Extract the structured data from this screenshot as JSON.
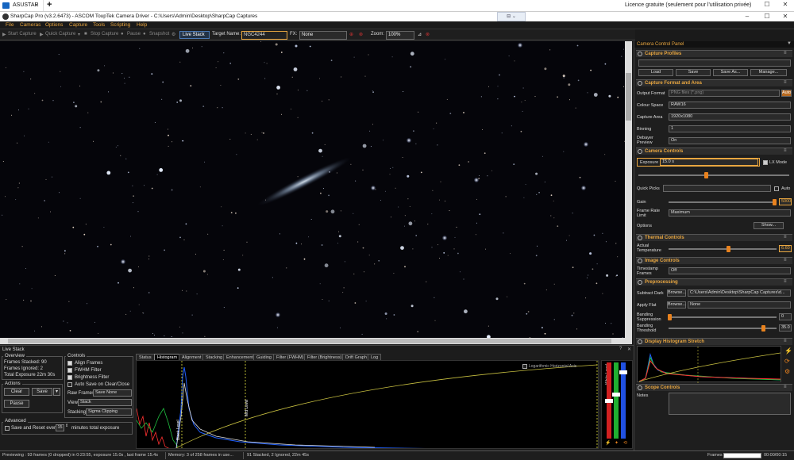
{
  "remote_tab": {
    "label": "ASUSTAR",
    "close": "×",
    "new": "+"
  },
  "license": "Licence gratuite (seulement pour l'utilisation privée)",
  "window": {
    "title": "SharpCap Pro (v3.2.6473) - ASCOM ToupTek Camera Driver - C:\\Users\\Admin\\Desktop\\SharpCap Captures",
    "min": "–",
    "max": "☐",
    "close": "✕"
  },
  "menu": [
    "File",
    "Cameras",
    "Options",
    "Capture",
    "Tools",
    "Scripting",
    "Help"
  ],
  "toolbar": {
    "start_capture": "Start Capture",
    "quick_capture": "Quick Capture",
    "stop_capture": "Stop Capture",
    "pause": "Pause",
    "snapshot": "Snapshot",
    "live_stack": "Live Stack",
    "target_label": "Target Name:",
    "target_value": "NGC4244",
    "fx_label": "FX:",
    "fx_value": "None",
    "zoom_label": "Zoom:",
    "zoom_value": "100%"
  },
  "right_panel": {
    "title": "Camera Control Panel",
    "capture_profiles": {
      "title": "Capture Profiles",
      "buttons": [
        "Load",
        "Save",
        "Save As...",
        "Manage..."
      ]
    },
    "format": {
      "title": "Capture Format and Area",
      "output_format_label": "Output Format",
      "output_format_value": "PNG files (*.png)",
      "auto": "Auto",
      "colour_space_label": "Colour Space",
      "colour_space_value": "RAW16",
      "capture_area_label": "Capture Area",
      "capture_area_value": "1920x1080",
      "binning_label": "Binning",
      "binning_value": "1",
      "debayer_label": "Debayer Preview",
      "debayer_value": "On"
    },
    "controls": {
      "title": "Camera Controls",
      "exposure_label": "Exposure",
      "exposure_value": "15.0 s",
      "lx_mode": "LX Mode",
      "quick_picks_label": "Quick Picks",
      "auto": "Auto",
      "gain_label": "Gain",
      "gain_value": "5000",
      "gain_level": 0.98,
      "frame_rate_label": "Frame Rate Limit",
      "frame_rate_value": "Maximum",
      "options_label": "Options",
      "show_button": "Show..."
    },
    "thermal": {
      "title": "Thermal Controls",
      "temp_label": "Actual Temperature",
      "temp_value": "6.60",
      "temp_level": 0.55
    },
    "image_controls": {
      "title": "Image Controls",
      "timestamp_label": "Timestamp Frames",
      "timestamp_value": "Off"
    },
    "preprocessing": {
      "title": "Preprocessing",
      "subtract_dark_label": "Subtract Dark",
      "browse": "Browse...",
      "dark_value": "C:\\Users\\Admin\\Desktop\\SharpCap Captures\\d...",
      "apply_flat_label": "Apply Flat",
      "flat_value": "None",
      "banding_supp_label": "Banding Suppression",
      "banding_supp_value": "0",
      "banding_thr_label": "Banding Threshold",
      "banding_thr_value": "35.0"
    },
    "histogram_stretch": {
      "title": "Display Histogram Stretch"
    },
    "scope": {
      "title": "Scope Controls",
      "notes_label": "Notes"
    }
  },
  "live_stack": {
    "title": "Live Stack",
    "overview": {
      "title": "Overview",
      "frames_stacked": "Frames Stacked: 90",
      "frames_ignored": "Frames Ignored: 2",
      "total_exposure": "Total Exposure  22m 30s"
    },
    "actions": {
      "title": "Actions",
      "clear": "Clear",
      "save": "Save",
      "pause": "Pause"
    },
    "advanced": {
      "title": "Advanced",
      "save_reset": "Save and Reset every",
      "minutes_value": "15",
      "minutes_label": "minutes total exposure"
    },
    "controls": {
      "title": "Controls",
      "align": "Align Frames",
      "fwhm": "FWHM Filter",
      "brightness": "Brightness Filter",
      "autosave": "Auto Save on Clear/Close",
      "raw_frames_label": "Raw Frames",
      "raw_frames_value": "Save None",
      "view_label": "View",
      "view_value": "Stack",
      "stacking_label": "Stacking",
      "stacking_value": "Sigma Clipping"
    },
    "tabs": [
      "Status",
      "Histogram",
      "Alignment",
      "Stacking",
      "Enhancement",
      "Guiding",
      "Filter (FWHM)",
      "Filter (Brightness)",
      "Drift Graph",
      "Log"
    ],
    "active_tab": "Histogram",
    "histogram": {
      "log_axis": "Logarithmic Horizontal Axis",
      "black_label": "Black Level",
      "mid_label": "Mid Level",
      "white_label": "White Level"
    }
  },
  "status_bar": {
    "preview": "Previewing : 93 frames (0 dropped) in 0:23:55, exposure 15.0s , last frame 15.4s",
    "memory": "Memory: 3 of 258 frames in use...",
    "stacked": "91 Stacked, 2 Ignored, 22m 45s",
    "frames_label": "Frames",
    "time": "00:00/00:15"
  }
}
